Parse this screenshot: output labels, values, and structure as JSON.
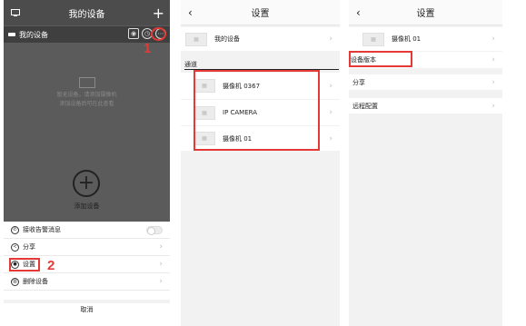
{
  "panel1": {
    "title": "我的设备",
    "device_name": "我的设备",
    "empty_line1": "暂无设备，请添加摄像机",
    "empty_line2": "添加设备后可在此查看",
    "add_label": "添加设备",
    "sheet": {
      "receive_alarm": "接收告警消息",
      "share": "分享",
      "settings": "设置",
      "delete": "删除设备",
      "cancel": "取消"
    }
  },
  "panel2": {
    "title": "设置",
    "device_name": "我的设备",
    "section": "通道",
    "channels": [
      "摄像机 0367",
      "IP CAMERA",
      "摄像机 01"
    ]
  },
  "panel3": {
    "title": "设置",
    "camera_name": "摄像机 01",
    "rows": [
      "设备版本",
      "分享",
      "远程配置"
    ]
  },
  "annotations": {
    "callout1": "1",
    "callout2": "2"
  },
  "colors": {
    "highlight": "#e53935",
    "dark_bg": "#5b5b5b"
  }
}
